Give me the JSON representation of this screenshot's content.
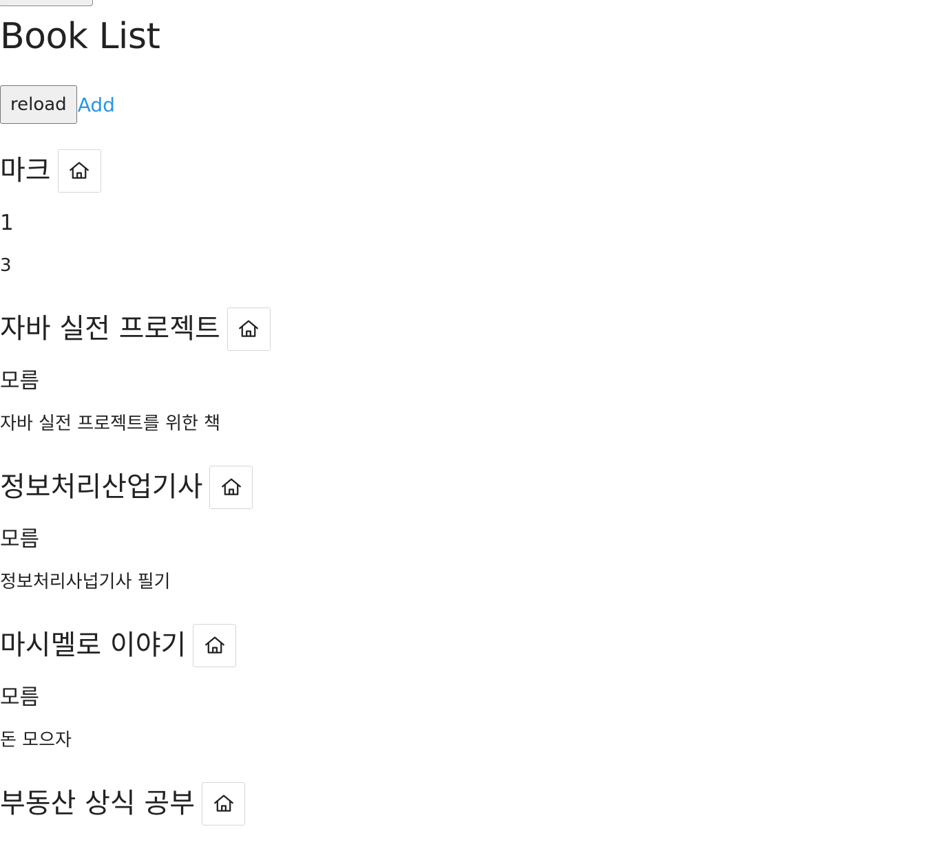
{
  "page": {
    "title": "Book List"
  },
  "toolbar": {
    "reload_label": "reload",
    "add_label": "Add"
  },
  "books": [
    {
      "title": "마크",
      "author": "1",
      "description": "3"
    },
    {
      "title": "자바 실전 프로젝트",
      "author": "모름",
      "description": "자바 실전 프로젝트를 위한 책"
    },
    {
      "title": "정보처리산업기사",
      "author": "모름",
      "description": "정보처리사넙기사 필기"
    },
    {
      "title": "마시멜로 이야기",
      "author": "모름",
      "description": "돈 모으자"
    },
    {
      "title": "부동산 상식 공부",
      "author": "",
      "description": ""
    }
  ],
  "icons": {
    "home": "home-icon"
  }
}
